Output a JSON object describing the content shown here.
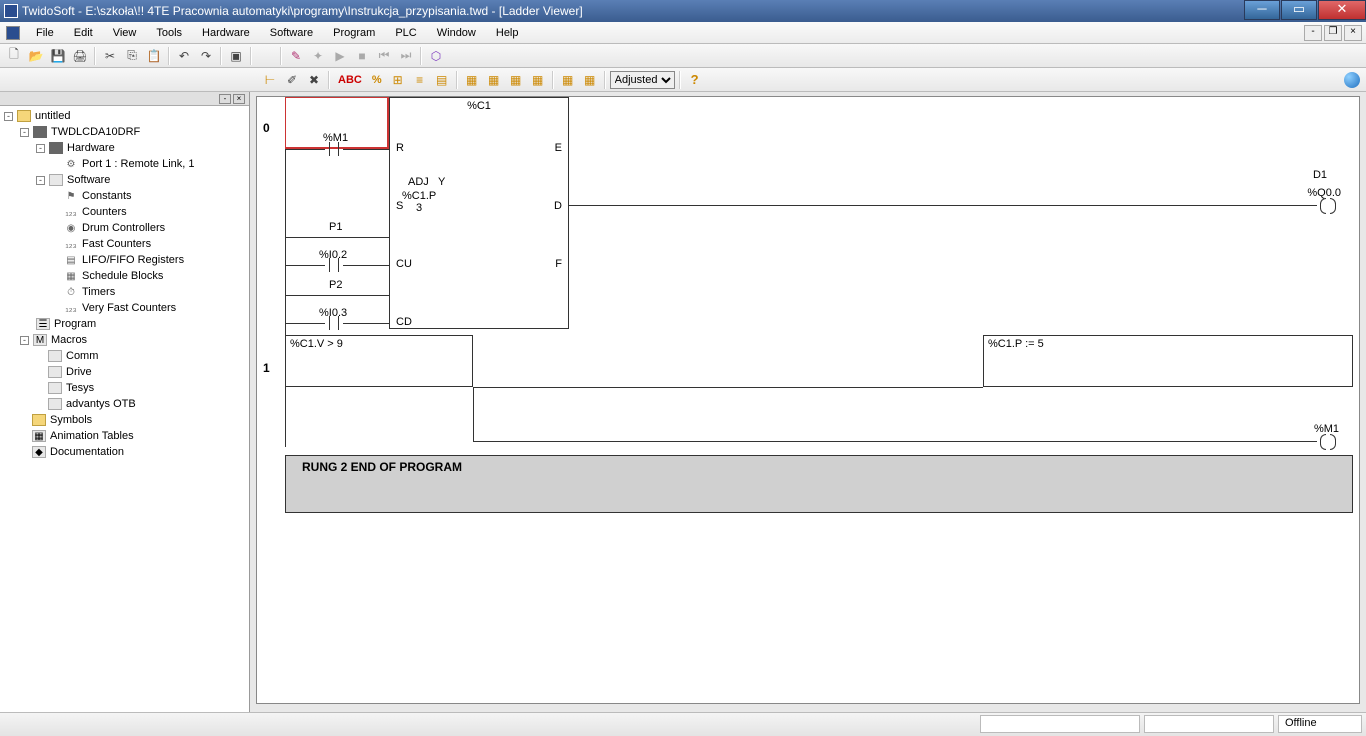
{
  "title": "TwidoSoft - E:\\szkoła\\!! 4TE Pracownia automatyki\\programy\\Instrukcja_przypisania.twd - [Ladder Viewer]",
  "menu": {
    "file": "File",
    "edit": "Edit",
    "view": "View",
    "tools": "Tools",
    "hardware": "Hardware",
    "software": "Software",
    "program": "Program",
    "plc": "PLC",
    "window": "Window",
    "help": "Help"
  },
  "toolbar2": {
    "abc": "ABC",
    "pct": "%",
    "zoom": "Adjusted",
    "help": "?"
  },
  "tree": {
    "root": "untitled",
    "device": "TWDLCDA10DRF",
    "hardware": "Hardware",
    "port1": "Port 1 : Remote Link, 1",
    "software": "Software",
    "constants": "Constants",
    "counters": "Counters",
    "drum": "Drum Controllers",
    "fastc": "Fast Counters",
    "lifo": "LIFO/FIFO Registers",
    "sched": "Schedule Blocks",
    "timers": "Timers",
    "vfast": "Very Fast Counters",
    "program": "Program",
    "macros": "Macros",
    "comm": "Comm",
    "drive": "Drive",
    "tesys": "Tesys",
    "advantys": "advantys OTB",
    "symbols": "Symbols",
    "anim": "Animation Tables",
    "doc": "Documentation"
  },
  "ladder": {
    "rung0": "0",
    "rung1": "1",
    "counter": {
      "title": "%C1",
      "r": "R",
      "s": "S",
      "cu": "CU",
      "cd": "CD",
      "e": "E",
      "d": "D",
      "f": "F",
      "adj": "ADJ",
      "adjv": "Y",
      "preset_lbl": "%C1.P",
      "preset_v": "3"
    },
    "m1": "%M1",
    "p1": "P1",
    "i02": "%I0.2",
    "p2": "P2",
    "i03": "%I0.3",
    "d1": "D1",
    "q00": "%Q0.0",
    "cmp": "%C1.V > 9",
    "assign": "%C1.P := 5",
    "m1_out": "%M1",
    "rung2": "RUNG 2       END OF PROGRAM"
  },
  "status": {
    "offline": "Offline"
  }
}
